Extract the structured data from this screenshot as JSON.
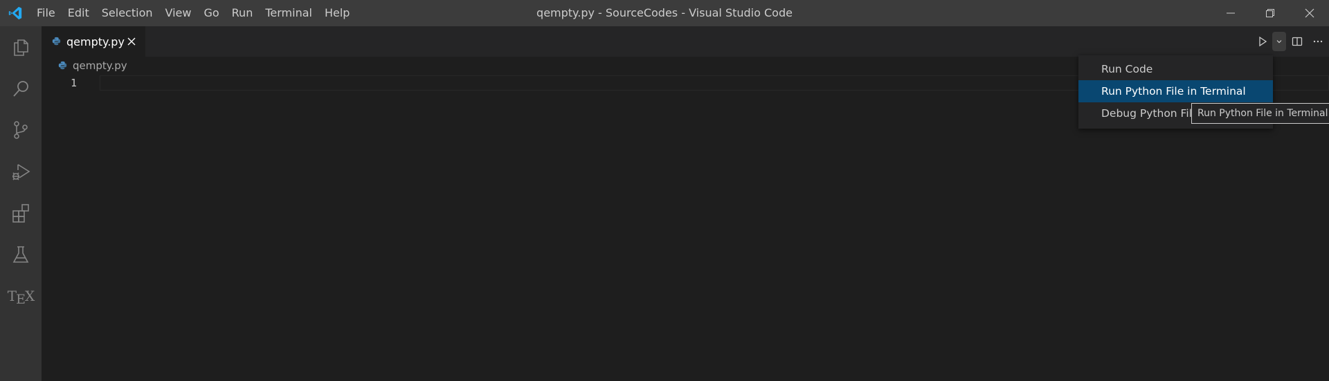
{
  "titlebar": {
    "menu": [
      "File",
      "Edit",
      "Selection",
      "View",
      "Go",
      "Run",
      "Terminal",
      "Help"
    ],
    "window_title": "qempty.py - SourceCodes - Visual Studio Code",
    "controls": [
      "minimize-icon",
      "restore-icon",
      "close-icon"
    ]
  },
  "activitybar": {
    "items": [
      "explorer-icon",
      "search-icon",
      "source-control-icon",
      "run-debug-icon",
      "extensions-icon",
      "testing-icon",
      "tex-icon"
    ],
    "tex_label_t": "T",
    "tex_label_e": "E",
    "tex_label_x": "X"
  },
  "tab": {
    "label": "qempty.py",
    "icon": "python-file-icon",
    "close": "close-icon"
  },
  "editor_actions": [
    "run-icon",
    "chevron-down-icon",
    "split-editor-icon",
    "more-actions-icon"
  ],
  "breadcrumb": {
    "label": "qempty.py"
  },
  "editor": {
    "line_numbers": [
      "1"
    ]
  },
  "dropdown": {
    "items": [
      "Run Code",
      "Run Python File in Terminal",
      "Debug Python File"
    ],
    "active_index": 1
  },
  "tooltip": {
    "text": "Run Python File in Terminal"
  },
  "colors": {
    "titlebar_bg": "#3c3c3c",
    "activitybar_bg": "#333333",
    "editor_bg": "#1e1e1e",
    "selection_bg": "#094771",
    "vscode_blue": "#23a9f2",
    "python_blue": "#4b8bbe"
  }
}
